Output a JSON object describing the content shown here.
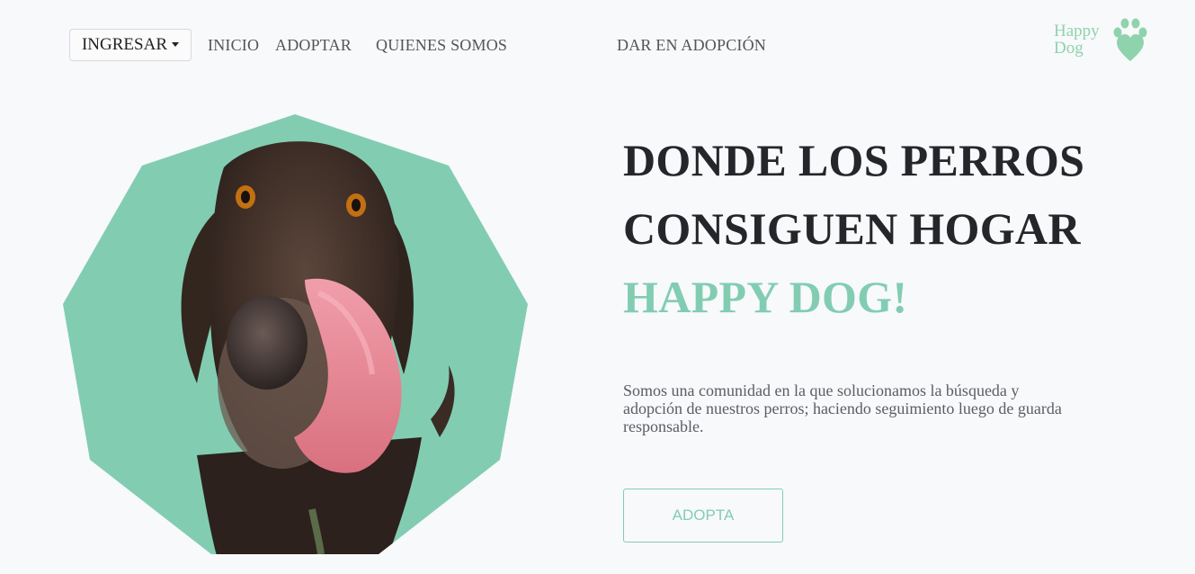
{
  "nav": {
    "login_label": "INGRESAR",
    "links": [
      {
        "label": "INICIO"
      },
      {
        "label": "ADOPTAR"
      },
      {
        "label": "QUIENES SOMOS"
      },
      {
        "label": "DAR EN ADOPCIÓN"
      }
    ],
    "logo": {
      "line1": "Happy",
      "line2": "Dog"
    }
  },
  "hero": {
    "title_line1": "DONDE LOS PERROS",
    "title_line2": "CONSIGUEN HOGAR",
    "title_brand": "HAPPY DOG!",
    "description": "Somos una comunidad en la que solucionamos la búsqueda y adopción de nuestros perros; haciendo seguimiento luego de guarda responsable.",
    "button_label": "ADOPTA"
  },
  "colors": {
    "accent": "#82cdb2",
    "logo": "#8fd3ad",
    "title": "#25262a",
    "background": "#f8f9fb",
    "dog_fur": "#3a2b24",
    "tongue": "#e98b99"
  },
  "icons": {
    "login_caret": "chevron-down-icon",
    "logo_mark": "paw-heart-icon"
  }
}
